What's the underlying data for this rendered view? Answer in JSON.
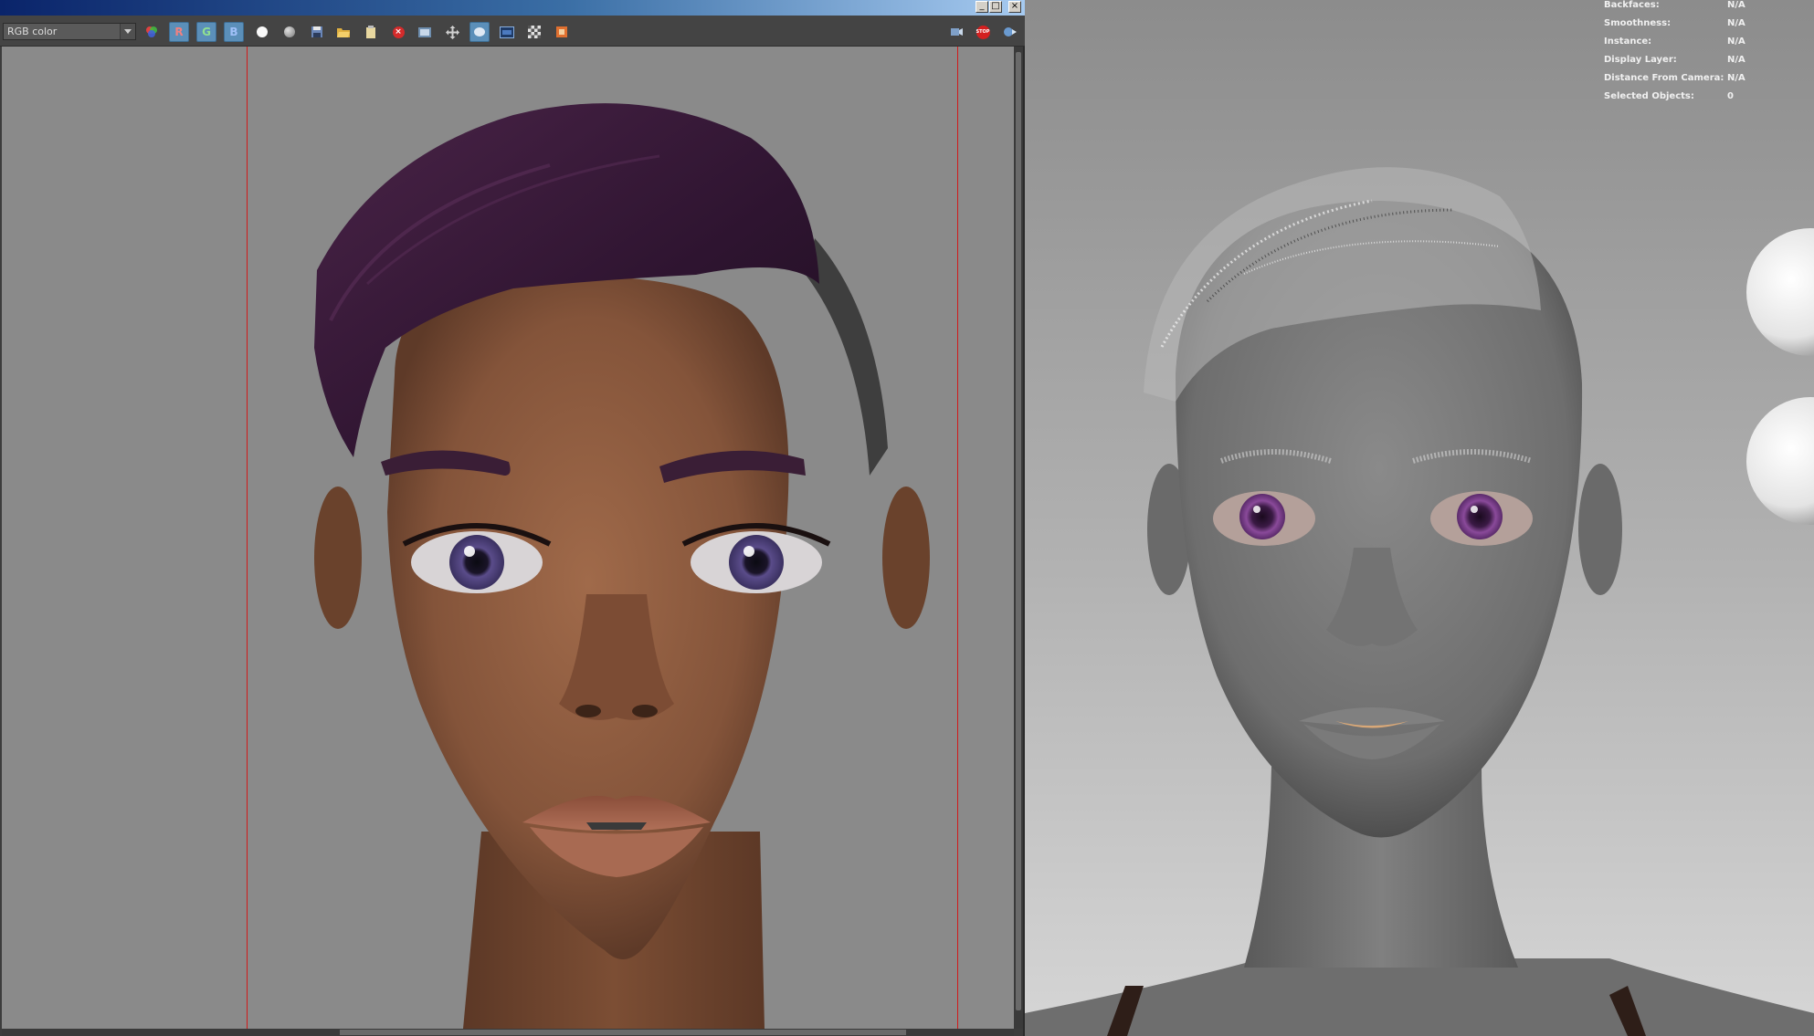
{
  "render_view": {
    "window_controls": {
      "minimize": "_",
      "maximize": "□",
      "close": "×"
    },
    "toolbar": {
      "channel_select": {
        "value": "RGB color"
      },
      "channel_buttons": {
        "red": "R",
        "green": "G",
        "blue": "B"
      },
      "icons": [
        "color-channels-icon",
        "red-channel-icon",
        "green-channel-icon",
        "blue-channel-icon",
        "white-circle-icon",
        "grey-sphere-icon",
        "save-image-icon",
        "open-folder-icon",
        "clipboard-icon",
        "stop-icon",
        "snapshot-icon",
        "move-icon",
        "region-render-icon",
        "framebuffer-icon",
        "checker-icon",
        "render-region-icon",
        "render-icon",
        "stop-render-icon",
        "ipr-icon"
      ],
      "stop_render_label": "STOP"
    },
    "colors": {
      "viewport_bg": "#8a8a8a",
      "region_line": "#d11a1a",
      "hair": "#3a1838",
      "skin": "#8a5a3e"
    }
  },
  "scene_viewport": {
    "hud": [
      {
        "key": "Backfaces:",
        "value": "N/A"
      },
      {
        "key": "Smoothness:",
        "value": "N/A"
      },
      {
        "key": "Instance:",
        "value": "N/A"
      },
      {
        "key": "Display Layer:",
        "value": "N/A"
      },
      {
        "key": "Distance From Camera:",
        "value": "N/A"
      },
      {
        "key": "Selected Objects:",
        "value": "0"
      }
    ],
    "colors": {
      "model_grey": "#7a7a7a",
      "iris": "#6a3a7a",
      "lips": "#d8a878"
    }
  }
}
